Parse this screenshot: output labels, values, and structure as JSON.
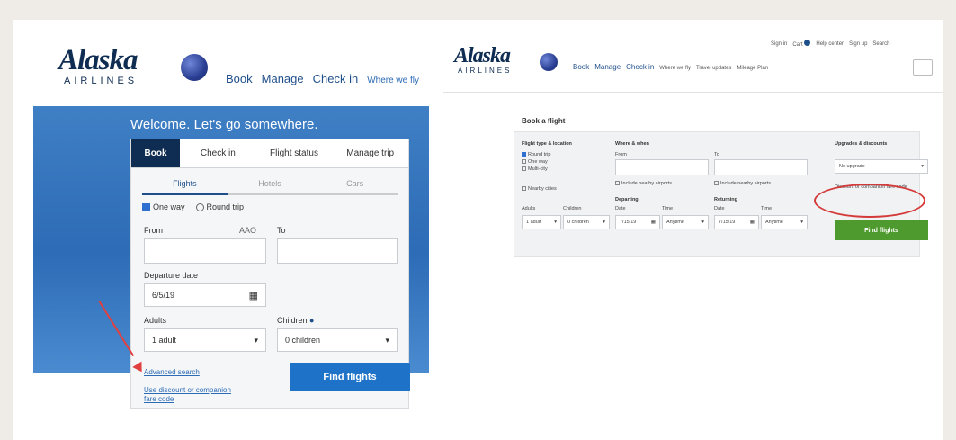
{
  "left": {
    "logo": {
      "word": "Alaska",
      "sub": "AIRLINES"
    },
    "nav": [
      "Book",
      "Manage",
      "Check in",
      "Where we fly"
    ],
    "welcome": "Welcome. Let's go somewhere.",
    "tabs": [
      "Book",
      "Check in",
      "Flight status",
      "Manage trip"
    ],
    "subtabs": [
      "Flights",
      "Hotels",
      "Cars"
    ],
    "trip_oneway": "One way",
    "trip_roundtrip": "Round trip",
    "from_label": "From",
    "from_code": "AAO",
    "to_label": "To",
    "departure_label": "Departure date",
    "departure_value": "6/5/19",
    "adults_label": "Adults",
    "adults_value": "1 adult",
    "children_label": "Children",
    "children_value": "0 children",
    "link_advanced": "Advanced search",
    "link_discount": "Use discount or companion fare code",
    "find_button": "Find flights"
  },
  "right": {
    "logo": {
      "word": "Alaska",
      "sub": "AIRLINES"
    },
    "top_links": [
      "Sign in",
      "Cart",
      "Help center",
      "Sign up",
      "Search"
    ],
    "nav": [
      "Book",
      "Manage",
      "Check in",
      "Where we fly",
      "Travel updates",
      "Mileage Plan"
    ],
    "title": "Book a flight",
    "trip_type_label": "Flight type & location",
    "trip_options": [
      "Round trip",
      "One way",
      "Multi-city"
    ],
    "nearby": "Nearby cities",
    "where_label": "Where & when",
    "from": "From",
    "to": "To",
    "chk_nearby_from": "Include nearby airports",
    "chk_nearby_to": "Include nearby airports",
    "departing": "Departing",
    "returning": "Returning",
    "date_label": "Date",
    "time_label": "Time",
    "date_value": "7/15/19",
    "time_value": "Anytime",
    "adults_label": "Adults",
    "adults_value": "1 adult",
    "children_label": "Children",
    "children_value": "0 children",
    "upgrades_label": "Upgrades & discounts",
    "upgrade_select": "No upgrade",
    "discount_code": "Discount or companion fare code",
    "find_button": "Find flights"
  }
}
